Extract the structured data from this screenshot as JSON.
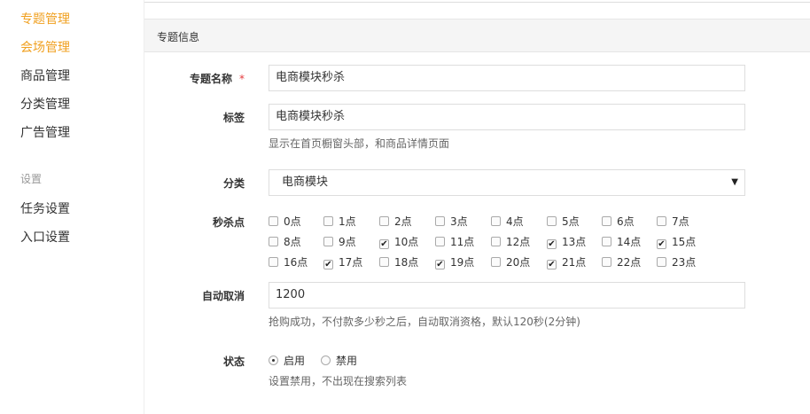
{
  "sidebar": {
    "items": [
      {
        "label": "专题管理",
        "active": true
      },
      {
        "label": "会场管理",
        "active": true
      },
      {
        "label": "商品管理",
        "active": false
      },
      {
        "label": "分类管理",
        "active": false
      },
      {
        "label": "广告管理",
        "active": false
      }
    ],
    "section": "设置",
    "section_items": [
      {
        "label": "任务设置"
      },
      {
        "label": "入口设置"
      }
    ],
    "accent_color": "#f0a020"
  },
  "panel": {
    "title": "专题信息"
  },
  "form": {
    "name": {
      "label": "专题名称",
      "required_mark": "*",
      "value": "电商模块秒杀"
    },
    "tag": {
      "label": "标签",
      "value": "电商模块秒杀",
      "help": "显示在首页橱窗头部，和商品详情页面"
    },
    "category": {
      "label": "分类",
      "value": "电商模块",
      "caret": "▼"
    },
    "seckill": {
      "label": "秒杀点",
      "rows": [
        [
          {
            "label": "0点",
            "checked": false
          },
          {
            "label": "1点",
            "checked": false
          },
          {
            "label": "2点",
            "checked": false
          },
          {
            "label": "3点",
            "checked": false
          },
          {
            "label": "4点",
            "checked": false
          },
          {
            "label": "5点",
            "checked": false
          },
          {
            "label": "6点",
            "checked": false
          },
          {
            "label": "7点",
            "checked": false
          }
        ],
        [
          {
            "label": "8点",
            "checked": false
          },
          {
            "label": "9点",
            "checked": false
          },
          {
            "label": "10点",
            "checked": true
          },
          {
            "label": "11点",
            "checked": false
          },
          {
            "label": "12点",
            "checked": false
          },
          {
            "label": "13点",
            "checked": true
          },
          {
            "label": "14点",
            "checked": false
          },
          {
            "label": "15点",
            "checked": true
          }
        ],
        [
          {
            "label": "16点",
            "checked": false
          },
          {
            "label": "17点",
            "checked": true
          },
          {
            "label": "18点",
            "checked": false
          },
          {
            "label": "19点",
            "checked": true
          },
          {
            "label": "20点",
            "checked": false
          },
          {
            "label": "21点",
            "checked": true
          },
          {
            "label": "22点",
            "checked": false
          },
          {
            "label": "23点",
            "checked": false
          }
        ]
      ]
    },
    "auto_cancel": {
      "label": "自动取消",
      "value": "1200",
      "help": "抢购成功，不付款多少秒之后，自动取消资格，默认120秒(2分钟)"
    },
    "status": {
      "label": "状态",
      "options": [
        {
          "label": "启用",
          "selected": true
        },
        {
          "label": "禁用",
          "selected": false
        }
      ],
      "help": "设置禁用，不出现在搜索列表"
    }
  }
}
